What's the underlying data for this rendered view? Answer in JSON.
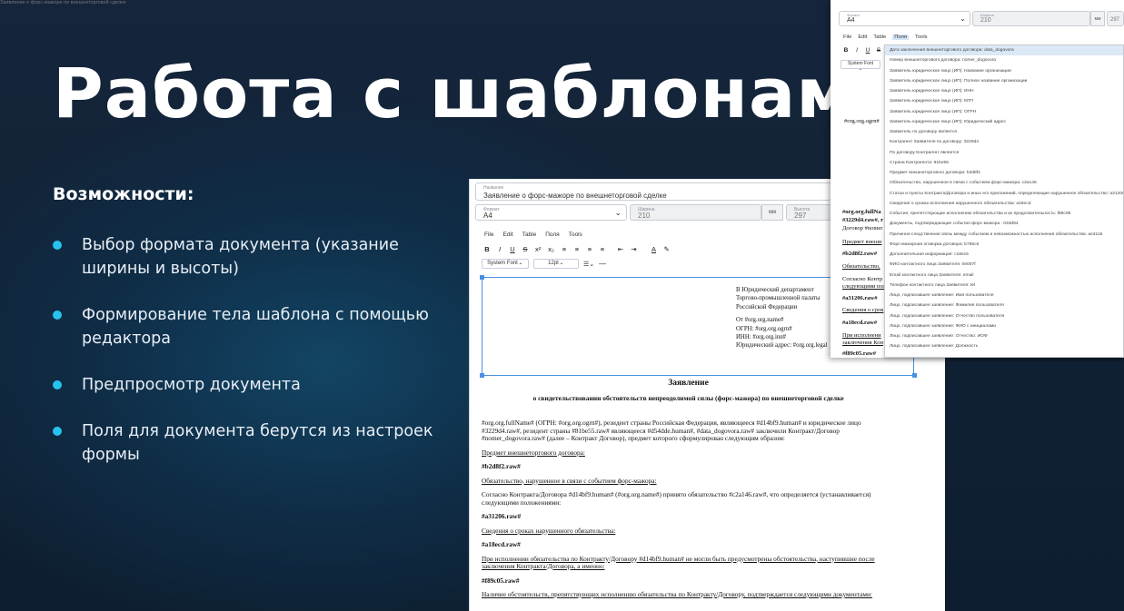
{
  "slide": {
    "title": "Работа с шаблонами",
    "subtitle": "Возможности:",
    "bullets": [
      "Выбор формата документа (указание ширины и высоты)",
      "Формирование тела шаблона с помощью редактора",
      "Предпросмотр документа",
      "Поля для документа берутся из настроек формы"
    ],
    "accent_color": "#27c3ef"
  },
  "editor": {
    "name_label": "Название",
    "name_value": "Заявление о форс-мажоре по внешнеторговой сделке",
    "format_label": "Формат",
    "format_value": "A4",
    "width_label": "Ширина",
    "width_value": "210",
    "height_label": "Высота",
    "height_value": "297",
    "unit": "мм",
    "menu": [
      "File",
      "Edit",
      "Table",
      "Поля",
      "Tools"
    ],
    "toolbar": [
      "B",
      "I",
      "U",
      "S",
      "x²",
      "x₂",
      "≡",
      "≡",
      "≡",
      "≡",
      "⇤",
      "⇥",
      "A",
      "✎"
    ],
    "font_family": "System Font",
    "font_size": "12pt",
    "address_lines": [
      "В Юридический департамент",
      "Торгово-промышленной палаты",
      "Российской Федерации",
      "",
      "От #org.org.name#",
      "ОГРН: #org.org.ogrn#",
      "ИНН: #org.org.inn#",
      "Юридический адрес: #org.org.legal"
    ],
    "doc_title": "Заявление",
    "doc_subtitle": "о свидетельствовании обстоятельств непреодолимой силы (форс-мажора) по внешнеторговой сделке",
    "paragraphs": [
      "#org.org.fullName# (ОГРН: #org.org.ogrn#), резидент страны Российская Федерация, являющееся #d14bf9.human# и юридическое лицо #3229d4.raw#, резидент страны #81be55.raw# являющееся #d54dde.human#, #data_dogovora.raw# заключили Контракт/Договор #nomer_dogovora.raw# (далее – Контракт Договор), предмет которого сформулирован следующим образом:",
      "Предмет внешнеторгового договора:",
      "#b2d8f2.raw#",
      "Обязательство, нарушенное в связи с событием форс-мажора:",
      "Согласно Контракта/Договора #d14bf9.human# (#org.org.name#) принято обязательство #c2a146.raw#, что определяется (устанавливается) следующими положениями:",
      "#a31206.raw#",
      "Сведения о сроках нарушенного обязательства:",
      "#a18ecd.raw#",
      "При исполнении обязательства по Контракту/Договору #d14bf9.human# не могли быть предусмотрены обстоятельства, наступившие после заключения Контракта/Договора, а именно:",
      "#f89c05.raw#",
      "Наличие обстоятельств, препятствующих исполнению обязательства по Контракту/Договору, подтверждается следующими документами:"
    ]
  },
  "popup": {
    "title_value": "Заявление о форс-мажоре по внешнеторговой сделке",
    "format_label": "Формат",
    "format_value": "A4",
    "width_label": "Ширина",
    "width_value": "210",
    "unit": "мм",
    "height_value": "297",
    "menu": [
      "File",
      "Edit",
      "Table",
      "Поля",
      "Tools"
    ],
    "active_menu": "Поля",
    "toolbar": [
      "B",
      "I",
      "U",
      "S"
    ],
    "font_family": "System Font",
    "left_fragments": [
      "#org.org.ogrn#",
      "#org.org.fullNa",
      "#3229d4.raw#, r",
      "Договор #nomer",
      "Предмет внешн",
      "#b2d8f2.raw#",
      "Обязательство,",
      "Согласно Контр",
      "следующими пол",
      "#a31206.raw#",
      "Сведения о срок",
      "#a18ecd.raw#",
      "При исполнени",
      "заключения Кон",
      "#f89c05.raw#"
    ],
    "fields": [
      "Дата заключения внешнеторгового договора: data_dogovora",
      "Номер внешнеторгового договора: nomer_dogovora",
      "Заявитель юридическое лицо (ИП): Название организации",
      "Заявитель юридическое лицо (ИП): Полное название организации",
      "Заявитель юридическое лицо (ИП): ИНН",
      "Заявитель юридическое лицо (ИП): КПП",
      "Заявитель юридическое лицо (ИП): ОГРН",
      "Заявитель юридическое лицо (ИП): Юридический адрес",
      "Заявитель по договору является",
      "Контрагент Заявителя по договору: 3229d4",
      "По договору Контрагент является",
      "Страна Контрагента: 81be55",
      "Предмет внешнеторгового договора: b2d8f2",
      "Обязательство, нарушенное в связи с событием форс-мажора: c2a146",
      "Статьи и пункты Контракта/Договора и иных его приложений, определяющие нарушенное обязательство: a31206",
      "Сведения о сроках исполнения нарушенного обязательства: a18ecd",
      "События, препятствующие исполнению обязательства и их продолжительность: f89c05",
      "Документы, подтверждающие события форс-мажора : 040d94",
      "Причинно-следственная связь между событием и невозможностью исполнения обязательства: ae3115",
      "Форс-мажорная оговорка договора: b755c5",
      "Дополнительная информация: c18ec5",
      "ФИО контактного лица Заявителя: 0e007f",
      "Email контактного лица Заявителя: email",
      "Телефон контактного лица Заявителя: tel",
      "Лицо, подписавшее заявление: Имя пользователя",
      "Лицо, подписавшее заявление: Фамилия пользователя",
      "Лицо, подписавшее заявление: Отчество пользователя",
      "Лицо, подписавшее заявление: ФИО с инициалами",
      "Лицо, подписавшее заявление: Отчество: ИОФ",
      "Лицо, подписавшее заявление: Должность"
    ]
  }
}
